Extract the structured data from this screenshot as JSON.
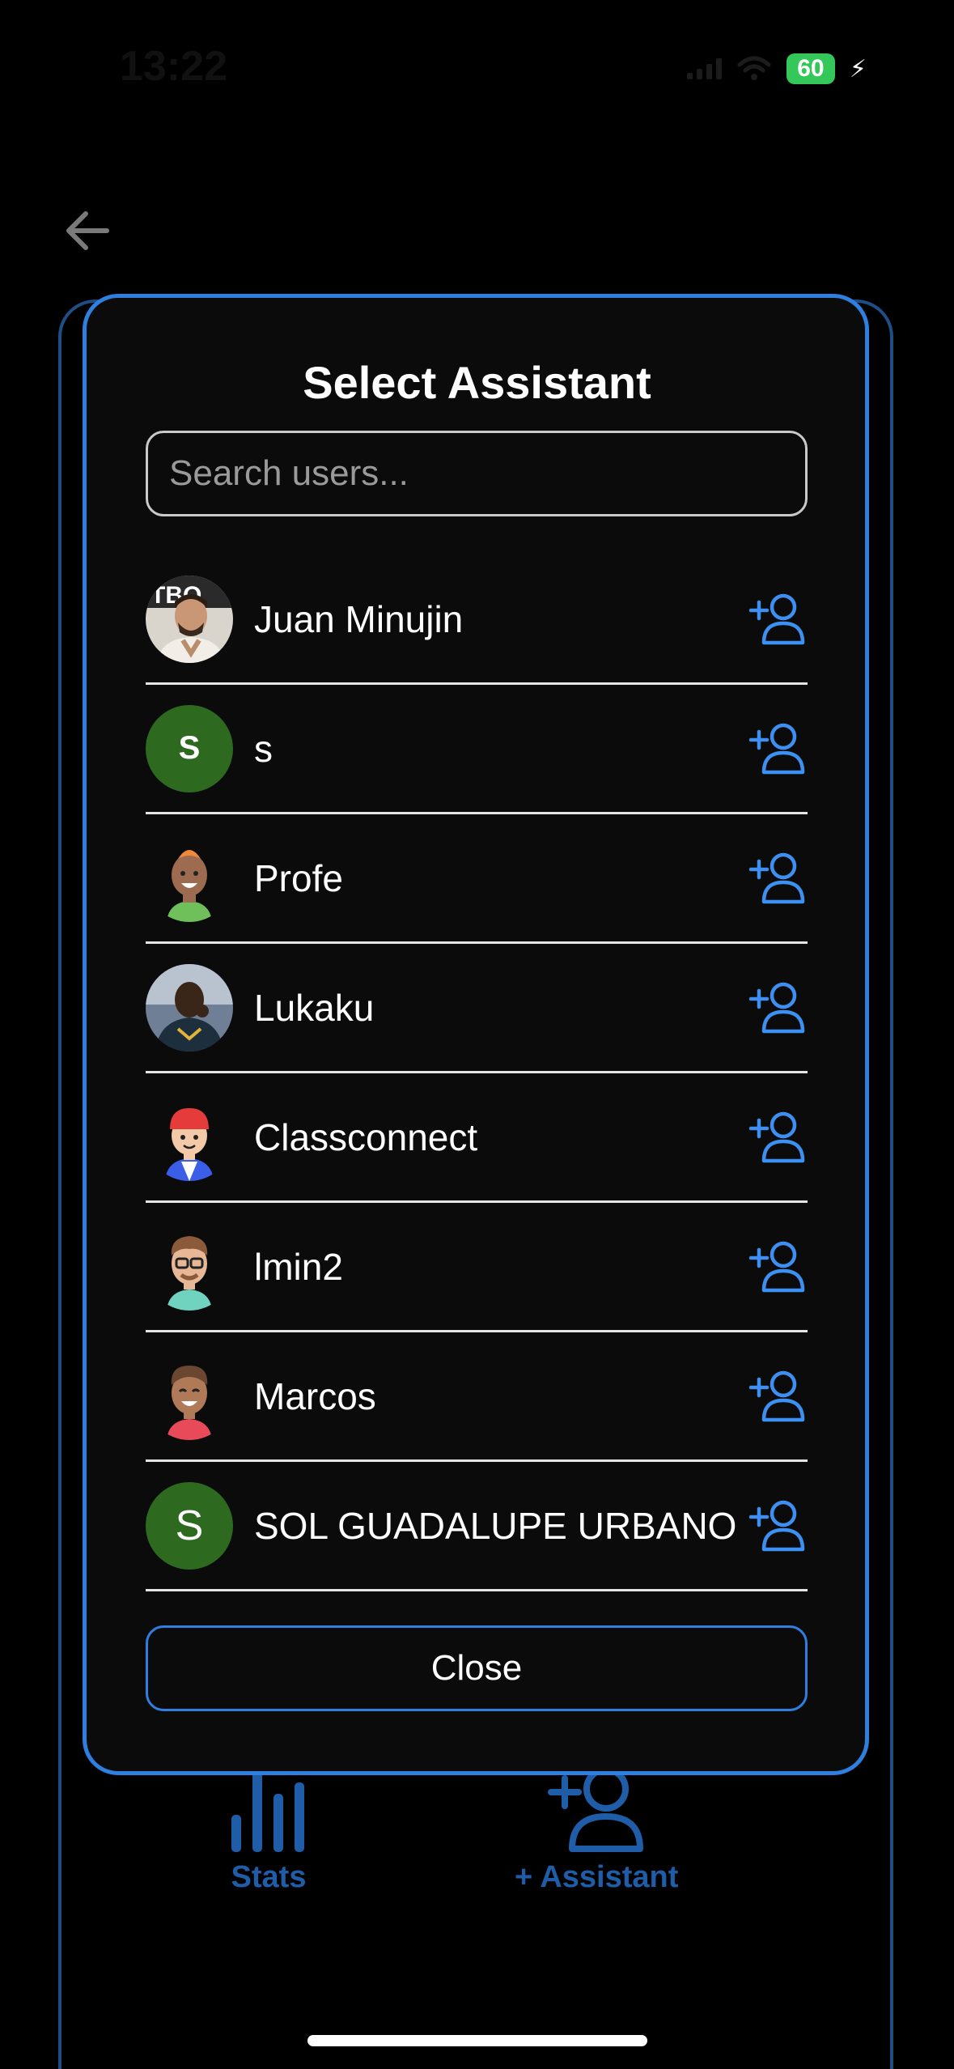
{
  "status_bar": {
    "time": "13:22",
    "battery": "60",
    "battery_color": "#34c759"
  },
  "background": {
    "back_icon": "arrow-left-icon",
    "actions": [
      {
        "label": "Stats",
        "icon": "bar-chart-icon"
      },
      {
        "label": "+ Assistant",
        "icon": "add-user-icon"
      }
    ]
  },
  "modal": {
    "title": "Select Assistant",
    "search": {
      "placeholder": "Search users...",
      "value": ""
    },
    "accent_color": "#2f7fe0",
    "users": [
      {
        "name": "Juan Minujin",
        "avatar": "photo-man-portrait"
      },
      {
        "name": "s",
        "avatar": "letter",
        "initial": "S"
      },
      {
        "name": "Profe",
        "avatar": "cartoon-bald-avatar"
      },
      {
        "name": "Lukaku",
        "avatar": "photo-footballer"
      },
      {
        "name": "Classconnect",
        "avatar": "cartoon-red-cap-avatar"
      },
      {
        "name": "lmin2",
        "avatar": "cartoon-glasses-avatar"
      },
      {
        "name": "Marcos",
        "avatar": "cartoon-curly-hair-avatar"
      },
      {
        "name": "SOL GUADALUPE URBANO",
        "avatar": "letter",
        "initial": "S"
      }
    ],
    "close_label": "Close"
  }
}
